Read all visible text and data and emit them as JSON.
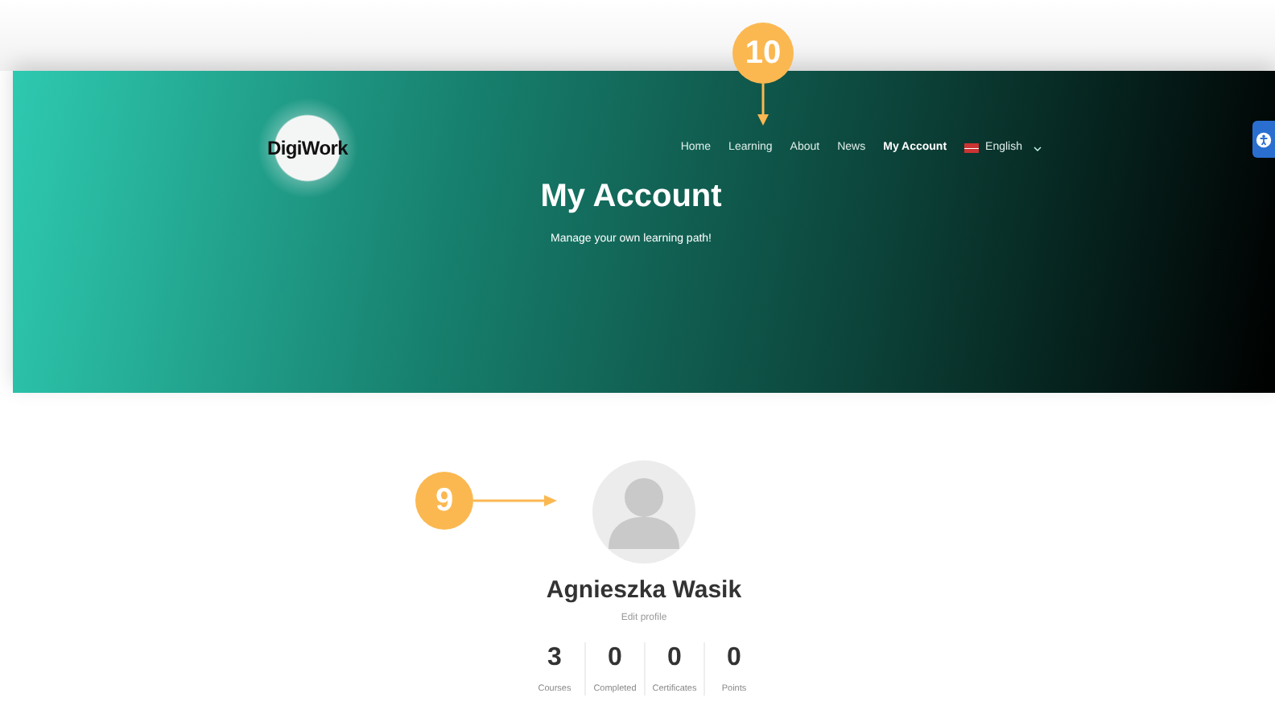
{
  "logo": {
    "text": "DigiWork"
  },
  "nav": [
    {
      "label": "Home",
      "selected": false
    },
    {
      "label": "Learning",
      "selected": false
    },
    {
      "label": "About",
      "selected": false
    },
    {
      "label": "News",
      "selected": false
    },
    {
      "label": "My Account",
      "selected": true
    }
  ],
  "language": {
    "label": "English"
  },
  "hero": {
    "title": "My Account",
    "subtitle": "Manage your own learning path!"
  },
  "profile": {
    "name": "Agnieszka Wasik",
    "edit_link": "Edit profile",
    "stats": [
      {
        "value": "3",
        "label": "Courses"
      },
      {
        "value": "0",
        "label": "Completed"
      },
      {
        "value": "0",
        "label": "Certificates"
      },
      {
        "value": "0",
        "label": "Points"
      }
    ]
  },
  "callouts": [
    {
      "number": "10"
    },
    {
      "number": "9"
    }
  ]
}
